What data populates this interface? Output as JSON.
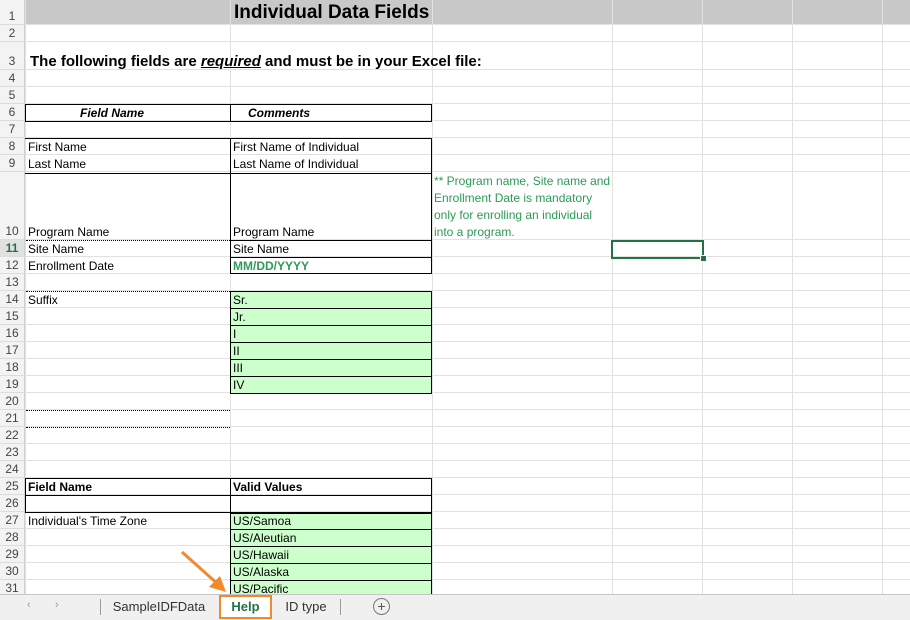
{
  "sheet": {
    "title": "Individual Data Fields",
    "intro": {
      "pre": "The following fields are ",
      "emphasis": "required",
      "post": " and must be in your Excel file:"
    },
    "table1": {
      "header_field": "Field Name",
      "header_comments": "Comments",
      "rows": [
        {
          "field": "First Name",
          "comment": "First Name of Individual"
        },
        {
          "field": "Last Name",
          "comment": "Last Name of Individual"
        },
        {
          "field": "Program Name",
          "comment": "Program Name"
        },
        {
          "field": "Site Name",
          "comment": "Site Name"
        },
        {
          "field": "Enrollment Date",
          "comment": "MM/DD/YYYY"
        }
      ]
    },
    "note": "** Program name, Site name and Enrollment Date is mandatory only for enrolling an individual into a program.",
    "suffix": {
      "label": "Suffix",
      "values": [
        "Sr.",
        "Jr.",
        "I",
        "II",
        "III",
        "IV"
      ]
    },
    "table2": {
      "header_field": "Field Name",
      "header_values": "Valid Values",
      "label": "Individual's Time Zone",
      "values": [
        "US/Samoa",
        "US/Aleutian",
        "US/Hawaii",
        "US/Alaska",
        "US/Pacific"
      ]
    },
    "row_numbers": [
      "1",
      "2",
      "3",
      "4",
      "5",
      "6",
      "7",
      "8",
      "9",
      "10",
      "11",
      "12",
      "13",
      "14",
      "15",
      "16",
      "17",
      "18",
      "19",
      "20",
      "21",
      "22",
      "23",
      "24",
      "25",
      "26",
      "27",
      "28",
      "29",
      "30",
      "31"
    ],
    "active_row": "11",
    "colors": {
      "accent": "#217346",
      "note_green": "#2e9a57",
      "valid_fill": "#ccffcc",
      "highlight": "#f28a2c"
    }
  },
  "tabs": [
    {
      "label": "SampleIDFData",
      "active": false
    },
    {
      "label": "Help",
      "active": true
    },
    {
      "label": "ID type",
      "active": false
    }
  ],
  "tabbar": {
    "prev_icon": "‹",
    "next_icon": "›",
    "add_icon": "+"
  }
}
